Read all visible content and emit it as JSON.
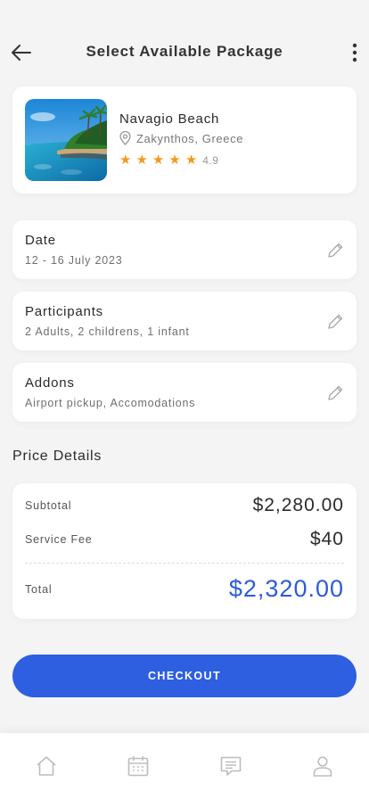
{
  "header": {
    "title": "Select Available Package"
  },
  "package": {
    "name": "Navagio Beach",
    "location": "Zakynthos, Greece",
    "stars": 5,
    "rating": "4.9"
  },
  "details": [
    {
      "label": "Date",
      "value": "12 - 16 July 2023"
    },
    {
      "label": "Participants",
      "value": "2 Adults, 2 childrens, 1 infant"
    },
    {
      "label": "Addons",
      "value": "Airport pickup, Accomodations"
    }
  ],
  "price_details": {
    "title": "Price Details",
    "subtotal_label": "Subtotal",
    "subtotal": "$2,280.00",
    "service_fee_label": "Service Fee",
    "service_fee": "$40",
    "total_label": "Total",
    "total": "$2,320.00"
  },
  "checkout_label": "CHECKOUT",
  "nav": [
    "home-icon",
    "calendar-icon",
    "chat-icon",
    "profile-icon"
  ],
  "colors": {
    "accent": "#2d5fe0",
    "total": "#2d5bd9",
    "star": "#f59a18",
    "background": "#f4f4f4"
  }
}
